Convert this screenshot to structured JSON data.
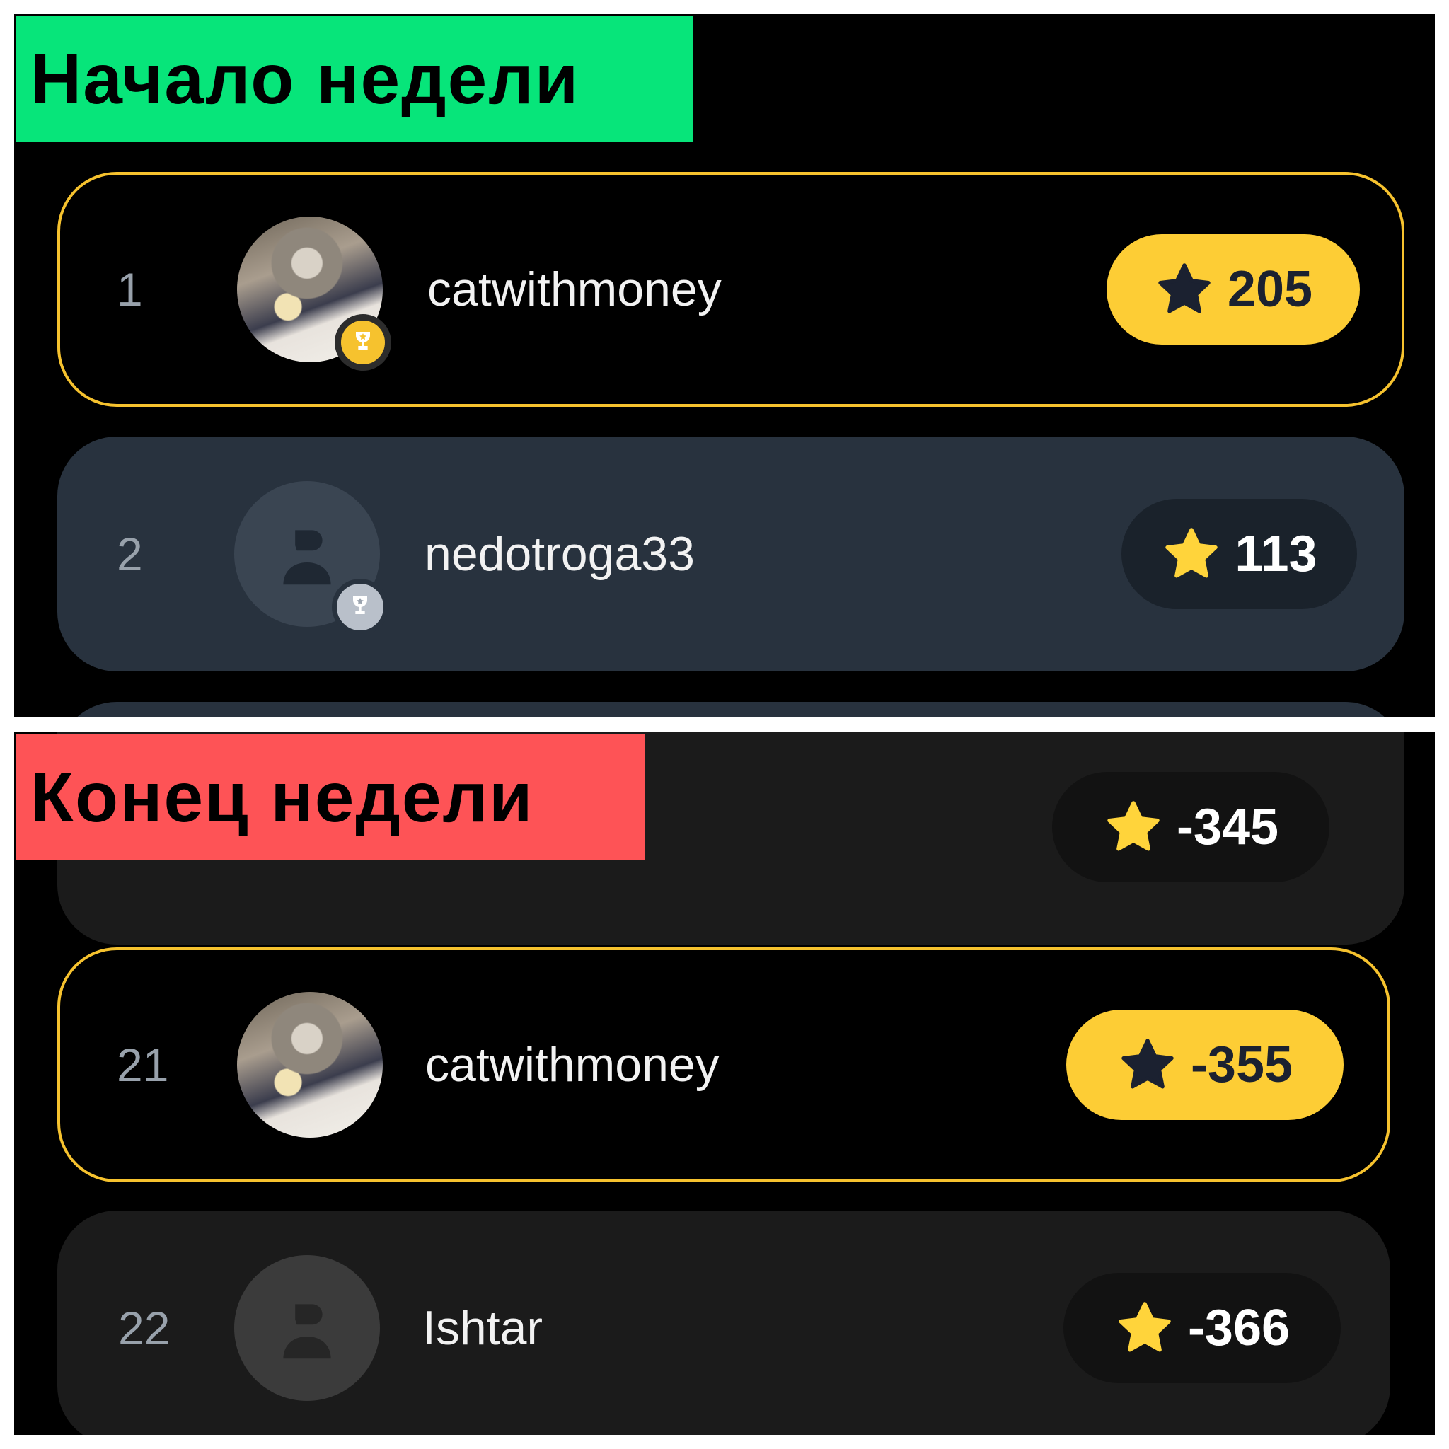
{
  "start_week": {
    "label": "Начало недели",
    "rows": [
      {
        "rank": "1",
        "username": "catwithmoney",
        "score": "205"
      },
      {
        "rank": "2",
        "username": "nedotroga33",
        "score": "113"
      }
    ]
  },
  "end_week": {
    "label": "Конец недели",
    "rows": [
      {
        "rank": "",
        "username": "",
        "score": "-345"
      },
      {
        "rank": "21",
        "username": "catwithmoney",
        "score": "-355"
      },
      {
        "rank": "22",
        "username": "Ishtar",
        "score": "-366"
      }
    ]
  },
  "colors": {
    "start_label_bg": "#07e57a",
    "end_label_bg": "#fe5356",
    "highlight_border": "#f6c22e",
    "score_yellow": "#fdcd35",
    "star_yellow": "#ffd43b",
    "star_dark": "#1b2130"
  },
  "icons": [
    "star-icon",
    "trophy-icon",
    "user-placeholder-icon"
  ]
}
